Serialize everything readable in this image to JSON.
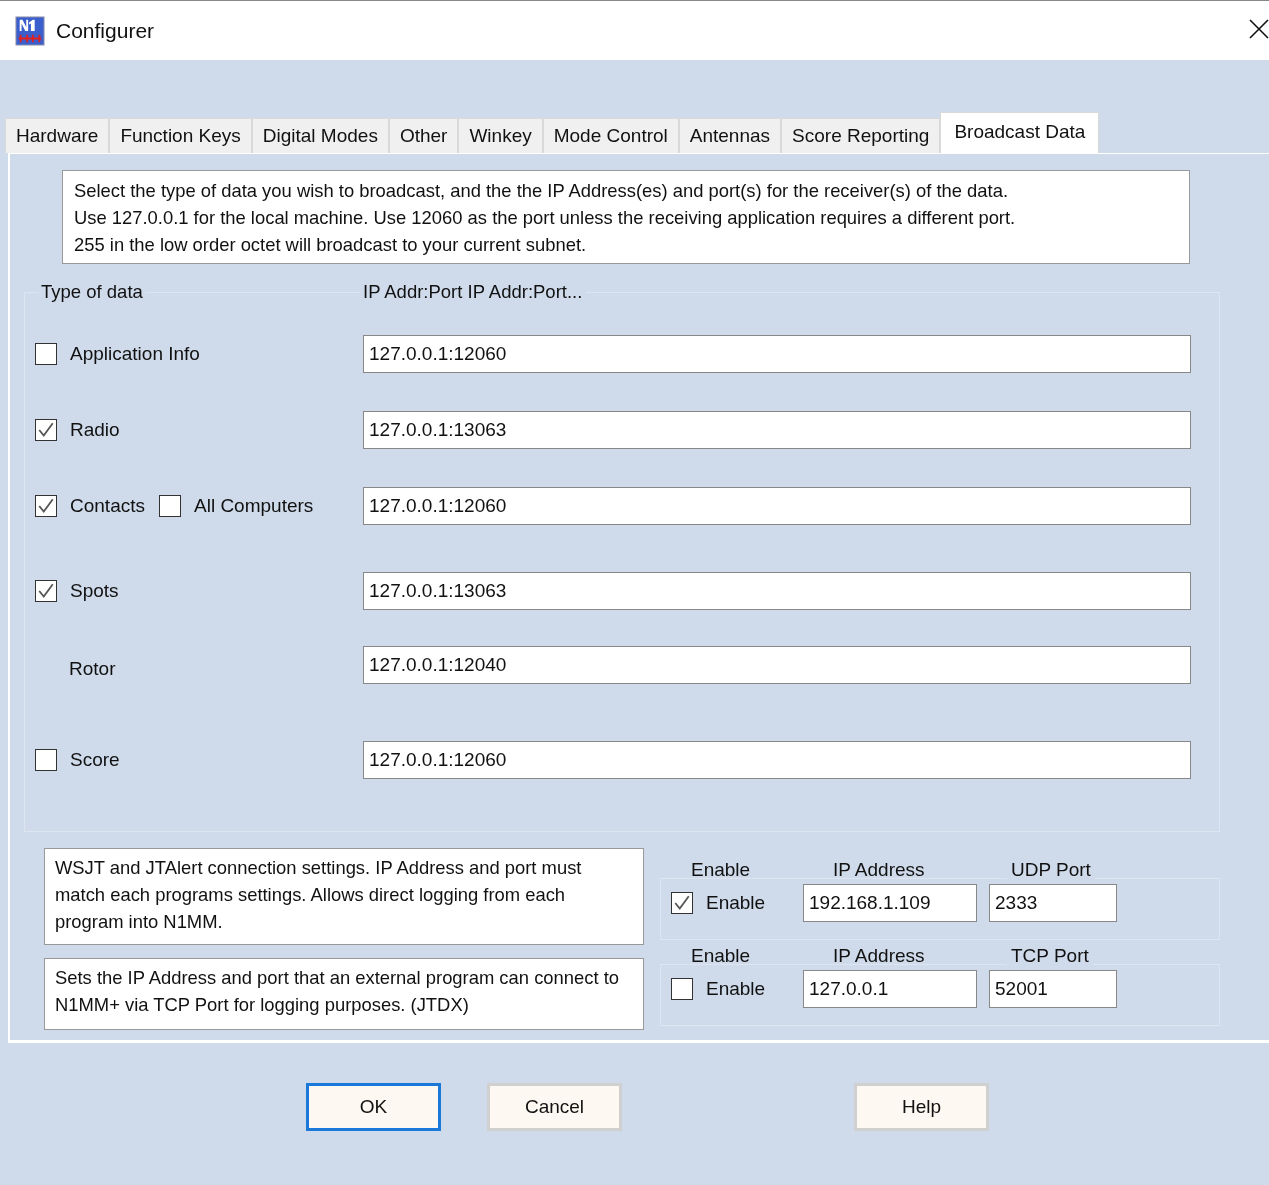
{
  "window": {
    "title": "Configurer"
  },
  "tabs": [
    {
      "label": "Hardware",
      "selected": false
    },
    {
      "label": "Function Keys",
      "selected": false
    },
    {
      "label": "Digital Modes",
      "selected": false
    },
    {
      "label": "Other",
      "selected": false
    },
    {
      "label": "Winkey",
      "selected": false
    },
    {
      "label": "Mode Control",
      "selected": false
    },
    {
      "label": "Antennas",
      "selected": false
    },
    {
      "label": "Score Reporting",
      "selected": false
    },
    {
      "label": "Broadcast Data",
      "selected": true
    }
  ],
  "description": [
    "Select the type of data you wish to broadcast, and the the IP Address(es) and port(s) for the receiver(s) of the data.",
    "Use 127.0.0.1 for the local machine.  Use 12060 as the port unless the receiving application requires a different port.",
    "255 in the low order octet will broadcast to your current subnet."
  ],
  "group": {
    "type_heading": "Type of data",
    "address_heading": "IP Addr:Port IP Addr:Port...",
    "rows": [
      {
        "kind": "checkbox",
        "label": "Application Info",
        "checked": false,
        "address": "127.0.0.1:12060"
      },
      {
        "kind": "checkbox",
        "label": "Radio",
        "checked": true,
        "address": "127.0.0.1:13063"
      },
      {
        "kind": "checkbox",
        "label": "Contacts",
        "checked": true,
        "address": "127.0.0.1:12060",
        "extra": {
          "label": "All Computers",
          "checked": false
        }
      },
      {
        "kind": "checkbox",
        "label": "Spots",
        "checked": true,
        "address": "127.0.0.1:13063"
      },
      {
        "kind": "plain",
        "label": "Rotor",
        "address": "127.0.0.1:12040"
      },
      {
        "kind": "checkbox",
        "label": "Score",
        "checked": false,
        "address": "127.0.0.1:12060"
      }
    ]
  },
  "connections": [
    {
      "note": "WSJT and JTAlert connection settings. IP Address and port must match each programs settings. Allows direct logging from each program into N1MM.",
      "enable_heading": "Enable",
      "ip_heading": "IP Address",
      "port_heading": "UDP Port",
      "enable_label": "Enable",
      "checked": true,
      "ip": "192.168.1.109",
      "port": "2333"
    },
    {
      "note": "Sets the IP Address and port that an external program can connect to N1MM+ via TCP Port for logging purposes. (JTDX)",
      "enable_heading": "Enable",
      "ip_heading": "IP Address",
      "port_heading": "TCP Port",
      "enable_label": "Enable",
      "checked": false,
      "ip": "127.0.0.1",
      "port": "52001"
    }
  ],
  "buttons": [
    {
      "label": "OK",
      "default": true
    },
    {
      "label": "Cancel",
      "default": false
    },
    {
      "label": "Help",
      "default": false
    }
  ]
}
